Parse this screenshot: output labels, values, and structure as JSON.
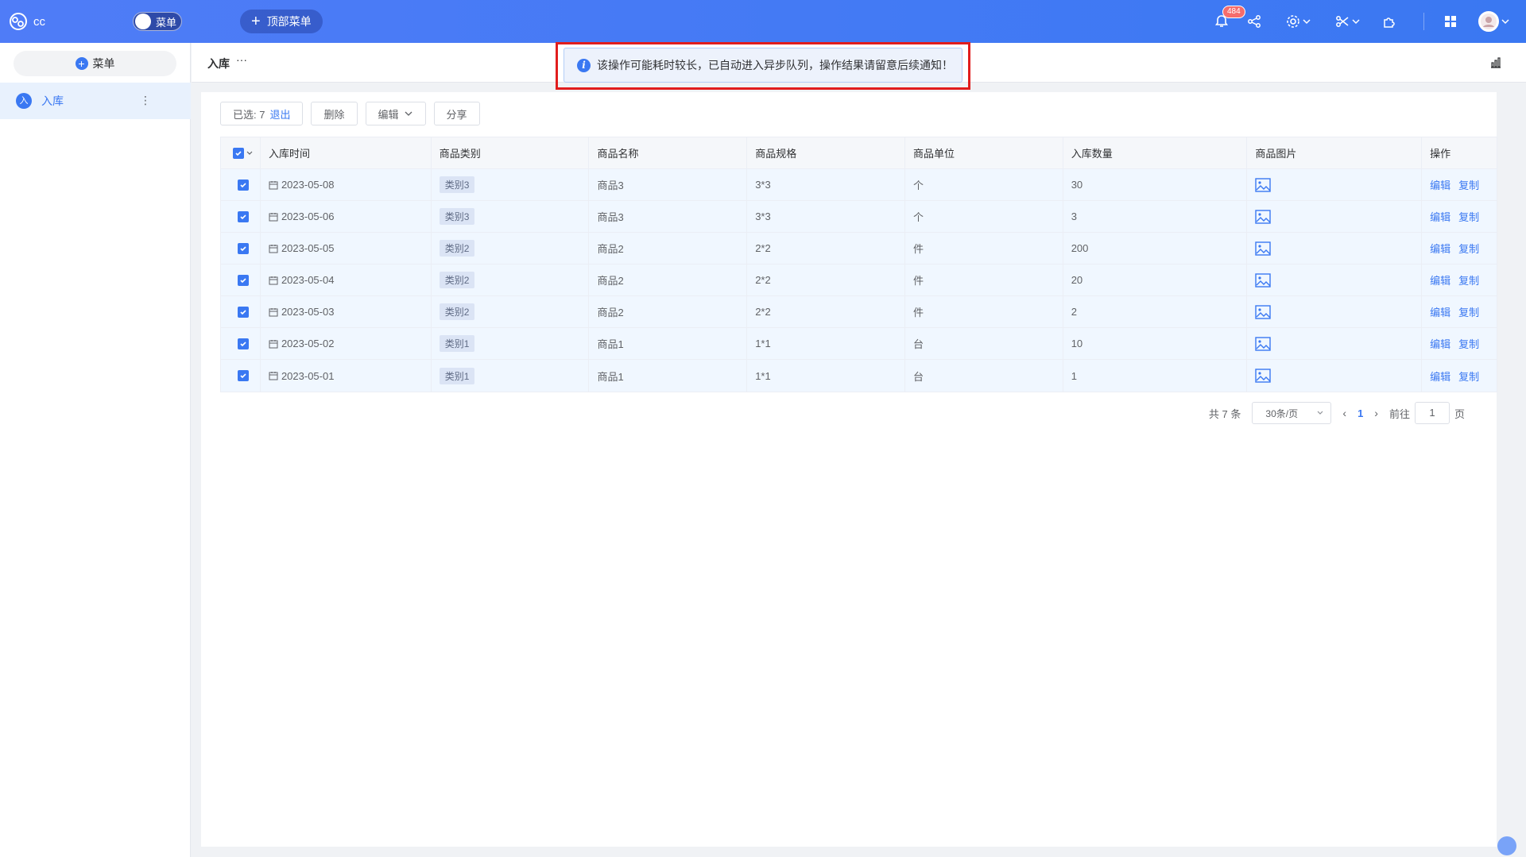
{
  "app": {
    "name": "cc",
    "menu_toggle_label": "菜单",
    "top_menu_label": "顶部菜单"
  },
  "header": {
    "notification_count": "484"
  },
  "sidebar": {
    "add_label": "菜单",
    "items": [
      {
        "avatar": "入",
        "label": "入库"
      }
    ]
  },
  "page": {
    "title": "入库",
    "more": "···"
  },
  "notice": {
    "text": "该操作可能耗时较长，已自动进入异步队列，操作结果请留意后续通知！"
  },
  "toolbar": {
    "selected_prefix": "已选: 7",
    "exit_label": "退出",
    "delete_label": "删除",
    "edit_label": "编辑",
    "share_label": "分享"
  },
  "table": {
    "columns": [
      "入库时间",
      "商品类别",
      "商品名称",
      "商品规格",
      "商品单位",
      "入库数量",
      "商品图片",
      "操作"
    ],
    "rows": [
      {
        "date": "2023-05-08",
        "category": "类别3",
        "name": "商品3",
        "spec": "3*3",
        "unit": "个",
        "qty": "30"
      },
      {
        "date": "2023-05-06",
        "category": "类别3",
        "name": "商品3",
        "spec": "3*3",
        "unit": "个",
        "qty": "3"
      },
      {
        "date": "2023-05-05",
        "category": "类别2",
        "name": "商品2",
        "spec": "2*2",
        "unit": "件",
        "qty": "200"
      },
      {
        "date": "2023-05-04",
        "category": "类别2",
        "name": "商品2",
        "spec": "2*2",
        "unit": "件",
        "qty": "20"
      },
      {
        "date": "2023-05-03",
        "category": "类别2",
        "name": "商品2",
        "spec": "2*2",
        "unit": "件",
        "qty": "2"
      },
      {
        "date": "2023-05-02",
        "category": "类别1",
        "name": "商品1",
        "spec": "1*1",
        "unit": "台",
        "qty": "10"
      },
      {
        "date": "2023-05-01",
        "category": "类别1",
        "name": "商品1",
        "spec": "1*1",
        "unit": "台",
        "qty": "1"
      }
    ],
    "op_edit": "编辑",
    "op_copy": "复制"
  },
  "pager": {
    "total": "共 7 条",
    "page_size": "30条/页",
    "current": "1",
    "goto_label": "前往",
    "goto_value": "1",
    "page_suffix": "页"
  },
  "colors": {
    "primary": "#3a78f2",
    "highlight": "#e11d1d"
  }
}
